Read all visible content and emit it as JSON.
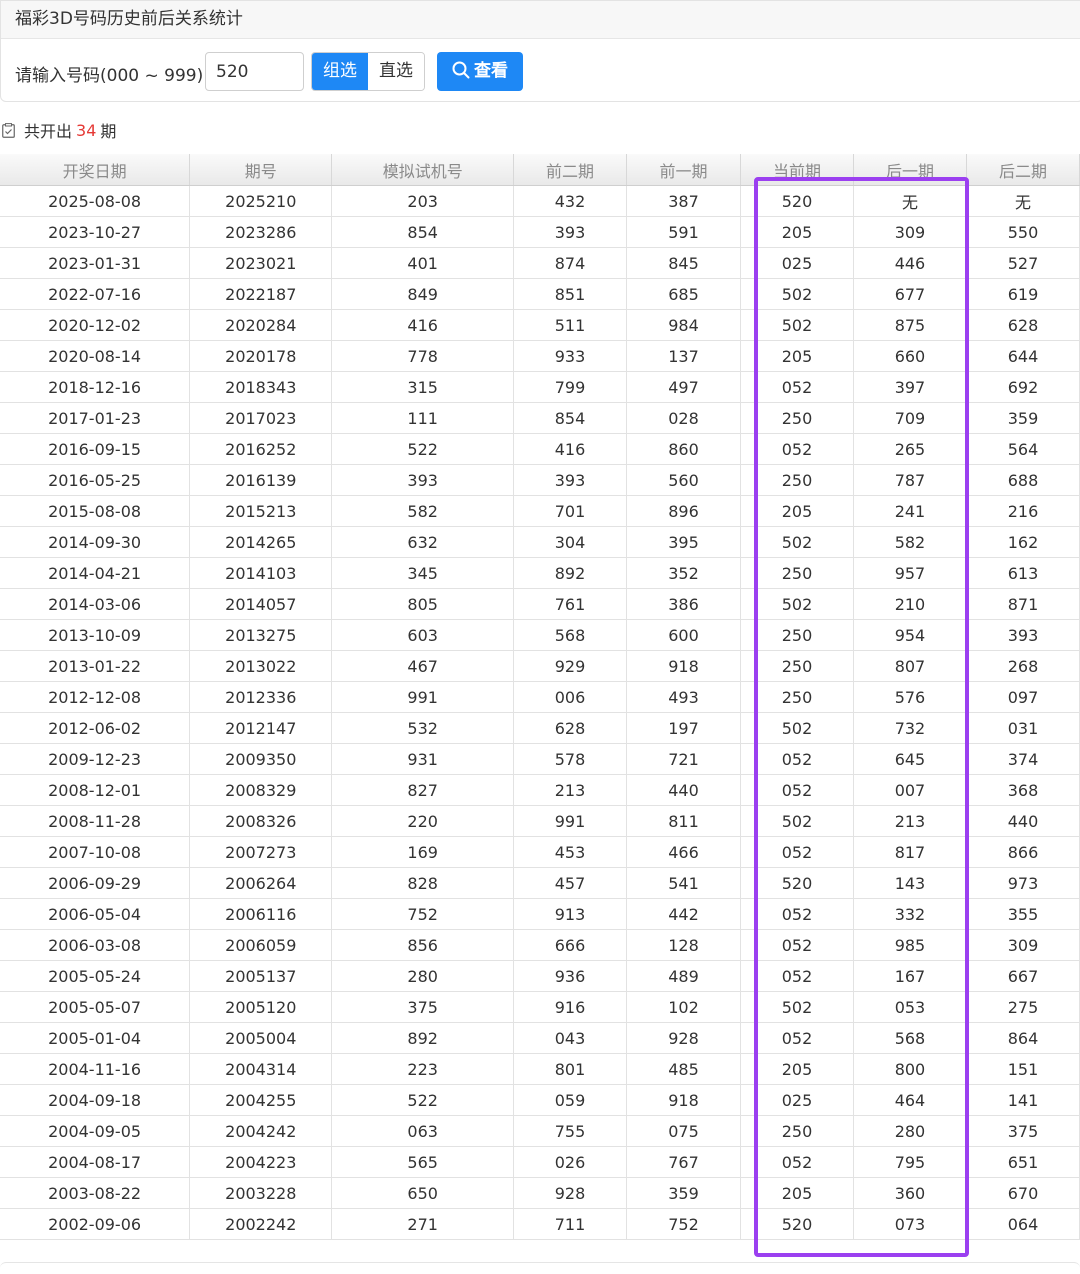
{
  "header": {
    "title": "福彩3D号码历史前后关系统计"
  },
  "search": {
    "label": "请输入号码(000 ~ 999)：",
    "value": "520",
    "mode_group": "组选",
    "mode_direct": "直选",
    "button": "查看"
  },
  "summary": {
    "prefix": "共开出",
    "count": "34",
    "suffix": "期"
  },
  "table": {
    "headers": [
      "开奖日期",
      "期号",
      "模拟试机号",
      "前二期",
      "前一期",
      "当前期",
      "后一期",
      "后二期"
    ],
    "rows": [
      [
        "2025-08-08",
        "2025210",
        "203",
        "432",
        "387",
        "520",
        "无",
        "无"
      ],
      [
        "2023-10-27",
        "2023286",
        "854",
        "393",
        "591",
        "205",
        "309",
        "550"
      ],
      [
        "2023-01-31",
        "2023021",
        "401",
        "874",
        "845",
        "025",
        "446",
        "527"
      ],
      [
        "2022-07-16",
        "2022187",
        "849",
        "851",
        "685",
        "502",
        "677",
        "619"
      ],
      [
        "2020-12-02",
        "2020284",
        "416",
        "511",
        "984",
        "502",
        "875",
        "628"
      ],
      [
        "2020-08-14",
        "2020178",
        "778",
        "933",
        "137",
        "205",
        "660",
        "644"
      ],
      [
        "2018-12-16",
        "2018343",
        "315",
        "799",
        "497",
        "052",
        "397",
        "692"
      ],
      [
        "2017-01-23",
        "2017023",
        "111",
        "854",
        "028",
        "250",
        "709",
        "359"
      ],
      [
        "2016-09-15",
        "2016252",
        "522",
        "416",
        "860",
        "052",
        "265",
        "564"
      ],
      [
        "2016-05-25",
        "2016139",
        "393",
        "393",
        "560",
        "250",
        "787",
        "688"
      ],
      [
        "2015-08-08",
        "2015213",
        "582",
        "701",
        "896",
        "205",
        "241",
        "216"
      ],
      [
        "2014-09-30",
        "2014265",
        "632",
        "304",
        "395",
        "502",
        "582",
        "162"
      ],
      [
        "2014-04-21",
        "2014103",
        "345",
        "892",
        "352",
        "250",
        "957",
        "613"
      ],
      [
        "2014-03-06",
        "2014057",
        "805",
        "761",
        "386",
        "502",
        "210",
        "871"
      ],
      [
        "2013-10-09",
        "2013275",
        "603",
        "568",
        "600",
        "250",
        "954",
        "393"
      ],
      [
        "2013-01-22",
        "2013022",
        "467",
        "929",
        "918",
        "250",
        "807",
        "268"
      ],
      [
        "2012-12-08",
        "2012336",
        "991",
        "006",
        "493",
        "250",
        "576",
        "097"
      ],
      [
        "2012-06-02",
        "2012147",
        "532",
        "628",
        "197",
        "502",
        "732",
        "031"
      ],
      [
        "2009-12-23",
        "2009350",
        "931",
        "578",
        "721",
        "052",
        "645",
        "374"
      ],
      [
        "2008-12-01",
        "2008329",
        "827",
        "213",
        "440",
        "052",
        "007",
        "368"
      ],
      [
        "2008-11-28",
        "2008326",
        "220",
        "991",
        "811",
        "502",
        "213",
        "440"
      ],
      [
        "2007-10-08",
        "2007273",
        "169",
        "453",
        "466",
        "052",
        "817",
        "866"
      ],
      [
        "2006-09-29",
        "2006264",
        "828",
        "457",
        "541",
        "520",
        "143",
        "973"
      ],
      [
        "2006-05-04",
        "2006116",
        "752",
        "913",
        "442",
        "052",
        "332",
        "355"
      ],
      [
        "2006-03-08",
        "2006059",
        "856",
        "666",
        "128",
        "052",
        "985",
        "309"
      ],
      [
        "2005-05-24",
        "2005137",
        "280",
        "936",
        "489",
        "052",
        "167",
        "667"
      ],
      [
        "2005-05-07",
        "2005120",
        "375",
        "916",
        "102",
        "502",
        "053",
        "275"
      ],
      [
        "2005-01-04",
        "2005004",
        "892",
        "043",
        "928",
        "052",
        "568",
        "864"
      ],
      [
        "2004-11-16",
        "2004314",
        "223",
        "801",
        "485",
        "205",
        "800",
        "151"
      ],
      [
        "2004-09-18",
        "2004255",
        "522",
        "059",
        "918",
        "025",
        "464",
        "141"
      ],
      [
        "2004-09-05",
        "2004242",
        "063",
        "755",
        "075",
        "250",
        "280",
        "375"
      ],
      [
        "2004-08-17",
        "2004223",
        "565",
        "026",
        "767",
        "052",
        "795",
        "651"
      ],
      [
        "2003-08-22",
        "2003228",
        "650",
        "928",
        "359",
        "205",
        "360",
        "670"
      ],
      [
        "2002-09-06",
        "2002242",
        "271",
        "711",
        "752",
        "520",
        "073",
        "064"
      ]
    ]
  },
  "colors": {
    "accent": "#1e88f5",
    "count_red": "#e53935",
    "highlight": "#9b3ff0"
  }
}
